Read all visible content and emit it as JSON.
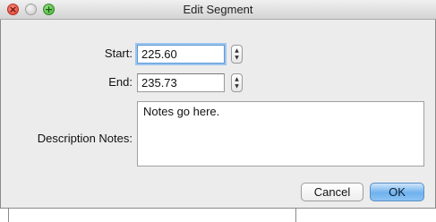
{
  "window": {
    "title": "Edit Segment"
  },
  "titlebar_icons": {
    "close": "close-icon",
    "minimize": "minimize-icon",
    "zoom": "zoom-icon",
    "close_glyph": "×",
    "zoom_glyph": "+"
  },
  "form": {
    "start_label": "Start:",
    "start_value": "225.60",
    "end_label": "End:",
    "end_value": "235.73",
    "notes_label": "Description Notes:",
    "notes_value": "Notes go here."
  },
  "stepper": {
    "up_glyph": "▲",
    "down_glyph": "▼"
  },
  "buttons": {
    "cancel": "Cancel",
    "ok": "OK"
  },
  "colors": {
    "ok_button": "#6fb1ee",
    "focus_ring": "#9ec4ee"
  }
}
